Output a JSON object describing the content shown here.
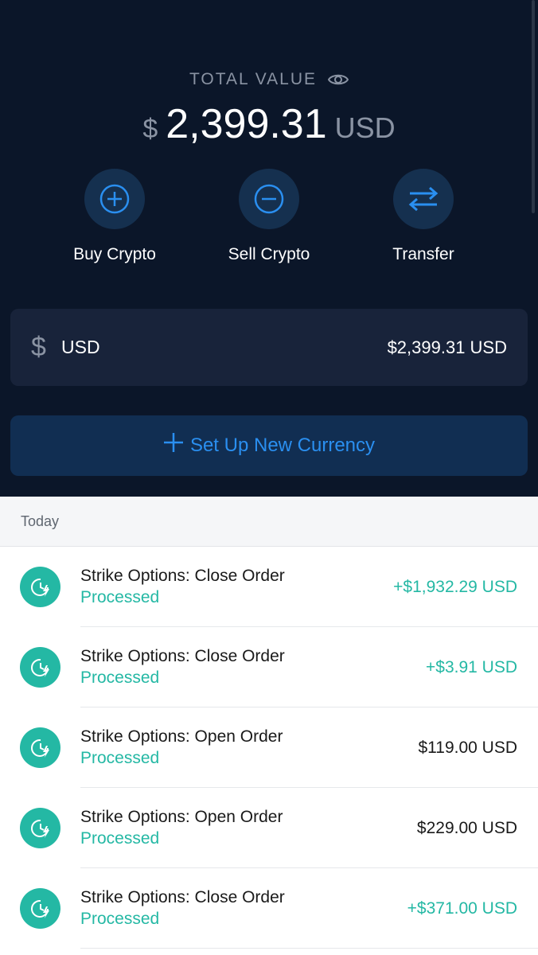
{
  "header": {
    "total_label": "TOTAL VALUE",
    "currency_symbol": "$",
    "total_amount": "2,399.31",
    "currency_code": "USD",
    "visibility_icon": "eye-icon"
  },
  "actions": [
    {
      "label": "Buy Crypto",
      "icon": "plus-circle-icon"
    },
    {
      "label": "Sell Crypto",
      "icon": "minus-circle-icon"
    },
    {
      "label": "Transfer",
      "icon": "transfer-arrows-icon"
    }
  ],
  "wallet": {
    "symbol": "$",
    "code": "USD",
    "balance": "$2,399.31 USD"
  },
  "setup_button": {
    "icon": "plus-icon",
    "label": "Set Up New Currency"
  },
  "section": {
    "title": "Today"
  },
  "transactions": [
    {
      "title": "Strike Options: Close Order",
      "status": "Processed",
      "amount": "+$1,932.29 USD",
      "positive": true,
      "icon": "clock-lightning-icon"
    },
    {
      "title": "Strike Options: Close Order",
      "status": "Processed",
      "amount": "+$3.91 USD",
      "positive": true,
      "icon": "clock-lightning-icon"
    },
    {
      "title": "Strike Options: Open Order",
      "status": "Processed",
      "amount": "$119.00 USD",
      "positive": false,
      "icon": "clock-lightning-icon"
    },
    {
      "title": "Strike Options: Open Order",
      "status": "Processed",
      "amount": "$229.00 USD",
      "positive": false,
      "icon": "clock-lightning-icon"
    },
    {
      "title": "Strike Options: Close Order",
      "status": "Processed",
      "amount": "+$371.00 USD",
      "positive": true,
      "icon": "clock-lightning-icon"
    }
  ],
  "colors": {
    "background_dark": "#0b1629",
    "accent_blue": "#2a8ff0",
    "accent_teal": "#24b8a4"
  }
}
